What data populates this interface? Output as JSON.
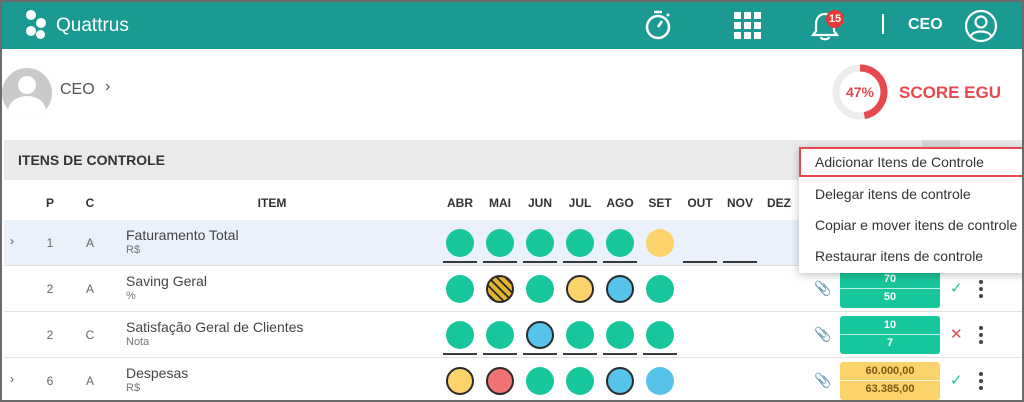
{
  "app": {
    "brand": "Quattrus"
  },
  "topbar": {
    "notification_count": "15",
    "user_label": "CEO",
    "icons": [
      "stopwatch-icon",
      "apps-grid-icon",
      "bell-icon",
      "account-circle-icon"
    ]
  },
  "profile": {
    "role": "CEO",
    "chevron": "›"
  },
  "score": {
    "percent": "47%",
    "value": 0.47,
    "label": "SCORE EGU",
    "color": "#e5484d"
  },
  "section": {
    "title": "ITENS DE CONTROLE"
  },
  "columns": {
    "p": "P",
    "c": "C",
    "item": "ITEM",
    "months": [
      "ABR",
      "MAI",
      "JUN",
      "JUL",
      "AGO",
      "SET",
      "OUT",
      "NOV",
      "DEZ"
    ]
  },
  "rows": [
    {
      "p": "1",
      "c": "A",
      "name": "Faturamento Total",
      "unit": "R$",
      "expandable": "›"
    },
    {
      "p": "2",
      "c": "A",
      "name": "Saving Geral",
      "unit": "%",
      "v1": "70",
      "v2": "50",
      "status": "✓"
    },
    {
      "p": "2",
      "c": "C",
      "name": "Satisfação Geral de Clientes",
      "unit": "Nota",
      "v1": "10",
      "v2": "7",
      "status": "✕"
    },
    {
      "p": "6",
      "c": "A",
      "name": "Despesas",
      "unit": "R$",
      "v1": "60.000,00",
      "v2": "63.385,00",
      "status": "✓",
      "expandable": "›"
    }
  ],
  "menu": {
    "items": [
      "Adicionar Itens de Controle",
      "Delegar itens de controle",
      "Copiar e mover itens de controle",
      "Restaurar itens de controle"
    ]
  },
  "colors": {
    "teal": "#1a9a92",
    "green": "#18c69b",
    "yellow": "#fcd36b",
    "red": "#f17273",
    "blue": "#55c3ea"
  }
}
